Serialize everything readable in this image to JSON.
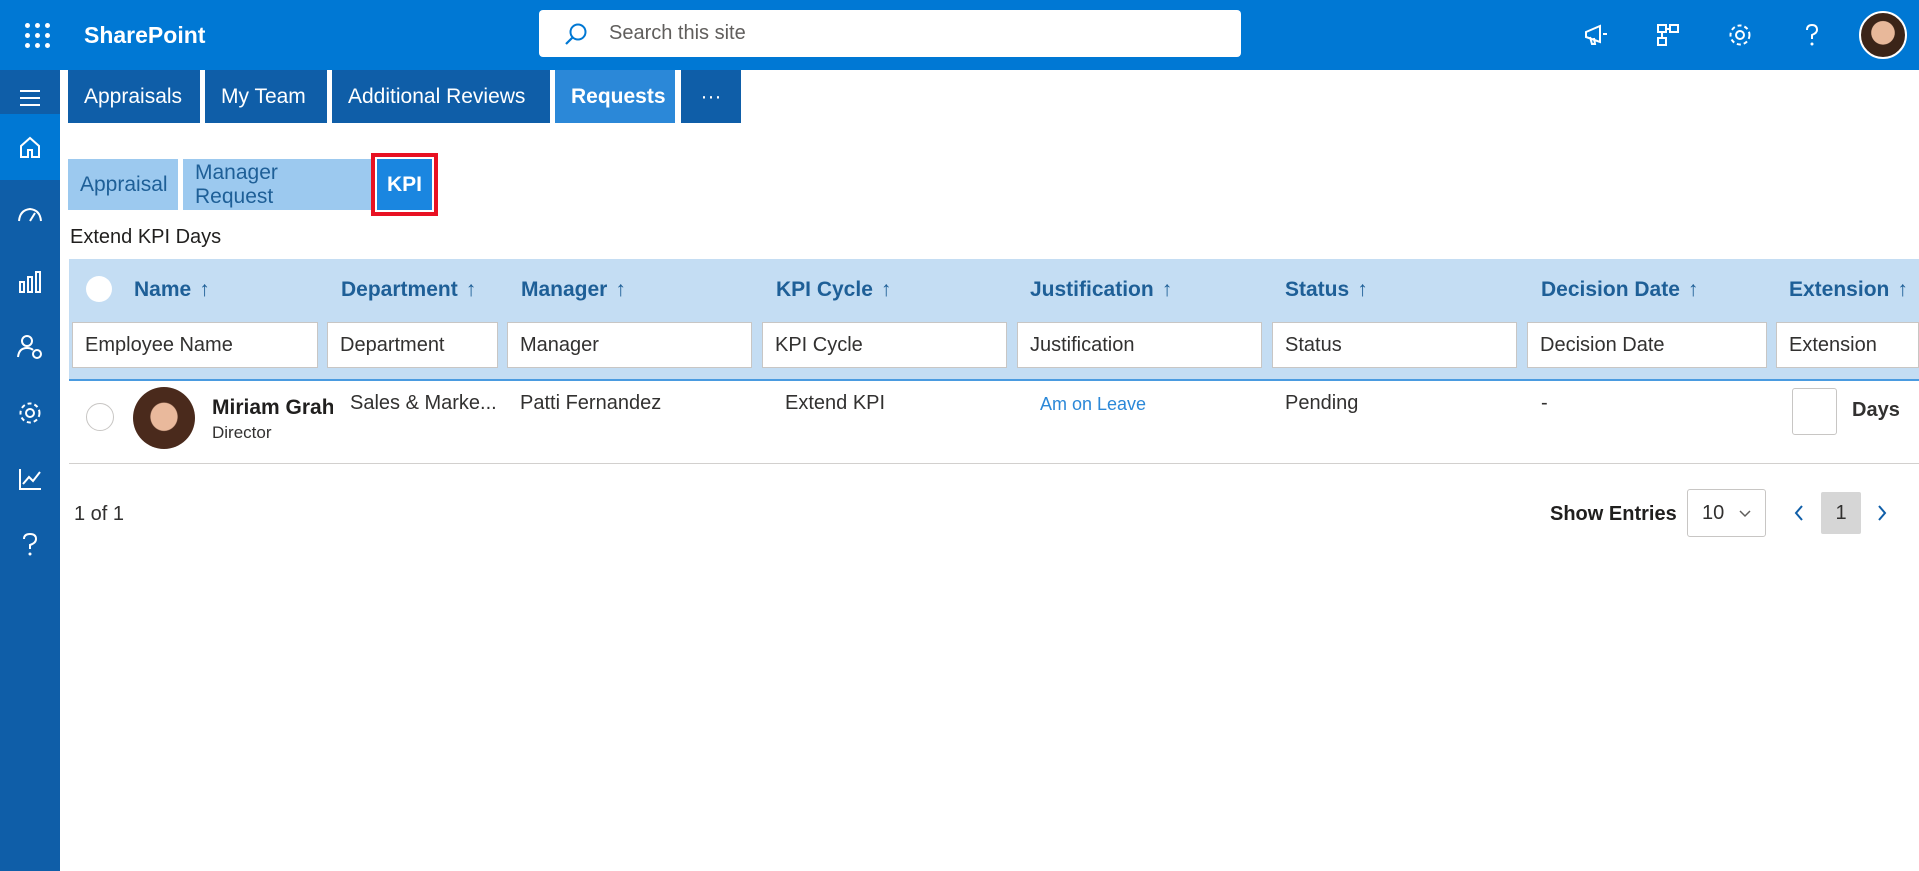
{
  "app": {
    "title": "SharePoint"
  },
  "search": {
    "placeholder": "Search this site"
  },
  "nav": {
    "tabs": [
      {
        "label": "Appraisals"
      },
      {
        "label": "My Team"
      },
      {
        "label": "Additional Reviews"
      },
      {
        "label": "Requests",
        "active": true
      },
      {
        "label": "···"
      }
    ]
  },
  "subtabs": [
    {
      "label": "Appraisal"
    },
    {
      "label": "Manager Request"
    },
    {
      "label": "KPI",
      "active": true
    }
  ],
  "section": {
    "title": "Extend KPI Days"
  },
  "grid": {
    "columns": [
      {
        "label": "Name",
        "filter_placeholder": "Employee Name"
      },
      {
        "label": "Department",
        "filter_placeholder": "Department"
      },
      {
        "label": "Manager",
        "filter_placeholder": "Manager"
      },
      {
        "label": "KPI Cycle",
        "filter_placeholder": "KPI Cycle"
      },
      {
        "label": "Justification",
        "filter_placeholder": "Justification"
      },
      {
        "label": "Status",
        "filter_placeholder": "Status"
      },
      {
        "label": "Decision Date",
        "filter_placeholder": "Decision Date"
      },
      {
        "label": "Extension",
        "filter_placeholder": "Extension"
      }
    ],
    "sort_arrow": "↑",
    "rows": [
      {
        "name": "Miriam Graham",
        "title": "Director",
        "department": "Sales & Marke...",
        "manager": "Patti Fernandez",
        "kpi_cycle": "Extend KPI",
        "justification": "Am on Leave",
        "status": "Pending",
        "decision_date": "-",
        "extension_unit": "Days"
      }
    ]
  },
  "footer": {
    "count": "1 of 1",
    "show_entries_label": "Show Entries",
    "page_size": "10",
    "current_page": "1"
  },
  "icons": {
    "waffle": "app-launcher-icon",
    "search": "search-icon",
    "megaphone": "megaphone-icon",
    "org": "org-chart-icon",
    "settings": "gear-icon",
    "help": "help-icon"
  },
  "colors": {
    "brand": "#0078d4",
    "rail": "#0f5ea8",
    "highlight": "#e81123"
  }
}
